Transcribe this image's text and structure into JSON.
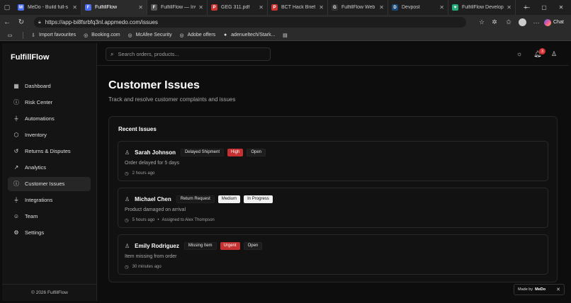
{
  "browser": {
    "tabs": [
      {
        "label": "MeDo - Build full-s",
        "fav": "M",
        "color": "#4c6ef5"
      },
      {
        "label": "FulfillFlow",
        "fav": "F",
        "color": "#4c6ef5",
        "active": true
      },
      {
        "label": "FulfillFlow — Invent",
        "fav": "F",
        "color": "#555"
      },
      {
        "label": "GEG 311.pdf",
        "fav": "P",
        "color": "#c33"
      },
      {
        "label": "BCT Hack Brief.pdf",
        "fav": "P",
        "color": "#c33"
      },
      {
        "label": "FulfillFlow Web App",
        "fav": "G",
        "color": "#333"
      },
      {
        "label": "Devpost",
        "fav": "D",
        "color": "#1b4a7a"
      },
      {
        "label": "FulfillFlow Develop",
        "fav": "✦",
        "color": "#2a7"
      }
    ],
    "url": "https://app-bi8fsrbfq3nl.appmedo.com/issues",
    "copilot_label": "Chat",
    "bookmarks": [
      {
        "label": "Import favourites",
        "icon": "import-icon"
      },
      {
        "label": "Booking.com",
        "icon": "globe-icon"
      },
      {
        "label": "McAfee Security",
        "icon": "globe-icon"
      },
      {
        "label": "Adobe offers",
        "icon": "globe-icon"
      },
      {
        "label": "adenueltech/Stark...",
        "icon": "github-icon"
      }
    ]
  },
  "app": {
    "brand": "FulfillFlow",
    "nav": [
      {
        "label": "Dashboard",
        "icon": "▦"
      },
      {
        "label": "Risk Center",
        "icon": "ⓘ"
      },
      {
        "label": "Automations",
        "icon": "⏚"
      },
      {
        "label": "Inventory",
        "icon": "⬡"
      },
      {
        "label": "Returns & Disputes",
        "icon": "↺"
      },
      {
        "label": "Analytics",
        "icon": "↗"
      },
      {
        "label": "Customer Issues",
        "icon": "ⓘ",
        "active": true
      },
      {
        "label": "Integrations",
        "icon": "⏚"
      },
      {
        "label": "Team",
        "icon": "☺"
      },
      {
        "label": "Settings",
        "icon": "⚙"
      }
    ],
    "footer": "© 2026 FulfillFlow",
    "search_placeholder": "Search orders, products...",
    "notification_count": "3"
  },
  "page": {
    "title": "Customer Issues",
    "subtitle": "Track and resolve customer complaints and issues",
    "card_title": "Recent Issues",
    "issues": [
      {
        "name": "Sarah Johnson",
        "category": "Delayed Shipment",
        "priority": "High",
        "priority_style": "red",
        "status": "Open",
        "status_style": "dark",
        "description": "Order delayed for 5 days",
        "time": "2 hours ago",
        "assigned": ""
      },
      {
        "name": "Michael Chen",
        "category": "Return Request",
        "priority": "Medium",
        "priority_style": "white",
        "status": "In Progress",
        "status_style": "white",
        "description": "Product damaged on arrival",
        "time": "5 hours ago",
        "assigned": "Assigned to Alex Thompson"
      },
      {
        "name": "Emily Rodriguez",
        "category": "Missing Item",
        "priority": "Urgent",
        "priority_style": "red",
        "status": "Open",
        "status_style": "dark",
        "description": "Item missing from order",
        "time": "30 minutes ago",
        "assigned": ""
      }
    ]
  },
  "madeby": {
    "prefix": "Made by",
    "brand": "MeDo"
  }
}
